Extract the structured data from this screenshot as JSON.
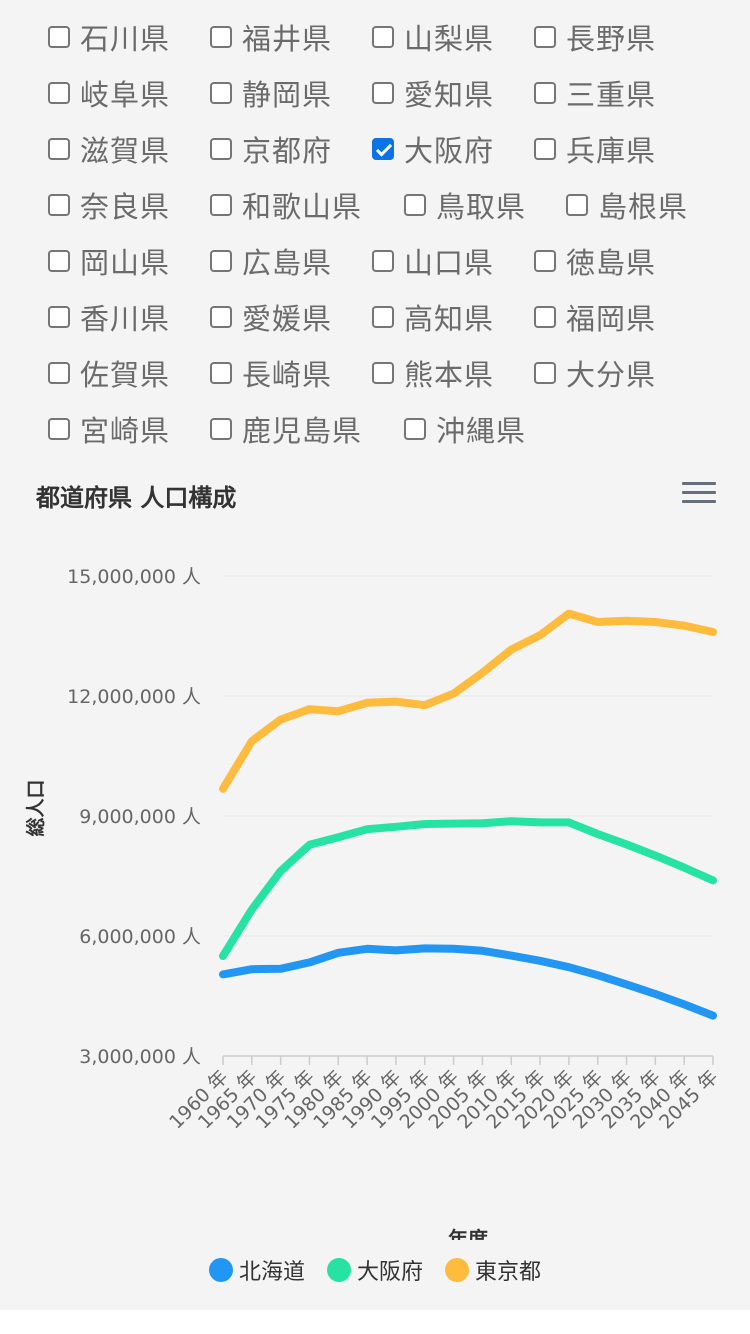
{
  "prefectures": [
    {
      "label": "石川県",
      "checked": false
    },
    {
      "label": "福井県",
      "checked": false
    },
    {
      "label": "山梨県",
      "checked": false
    },
    {
      "label": "長野県",
      "checked": false
    },
    {
      "label": "岐阜県",
      "checked": false
    },
    {
      "label": "静岡県",
      "checked": false
    },
    {
      "label": "愛知県",
      "checked": false
    },
    {
      "label": "三重県",
      "checked": false
    },
    {
      "label": "滋賀県",
      "checked": false
    },
    {
      "label": "京都府",
      "checked": false
    },
    {
      "label": "大阪府",
      "checked": true
    },
    {
      "label": "兵庫県",
      "checked": false
    },
    {
      "label": "奈良県",
      "checked": false
    },
    {
      "label": "和歌山県",
      "checked": false
    },
    {
      "label": "鳥取県",
      "checked": false
    },
    {
      "label": "島根県",
      "checked": false
    },
    {
      "label": "岡山県",
      "checked": false
    },
    {
      "label": "広島県",
      "checked": false
    },
    {
      "label": "山口県",
      "checked": false
    },
    {
      "label": "徳島県",
      "checked": false
    },
    {
      "label": "香川県",
      "checked": false
    },
    {
      "label": "愛媛県",
      "checked": false
    },
    {
      "label": "高知県",
      "checked": false
    },
    {
      "label": "福岡県",
      "checked": false
    },
    {
      "label": "佐賀県",
      "checked": false
    },
    {
      "label": "長崎県",
      "checked": false
    },
    {
      "label": "熊本県",
      "checked": false
    },
    {
      "label": "大分県",
      "checked": false
    },
    {
      "label": "宮崎県",
      "checked": false
    },
    {
      "label": "鹿児島県",
      "checked": false
    },
    {
      "label": "沖縄県",
      "checked": false
    }
  ],
  "chart_title": "都道府県 人口構成",
  "menu_icon": "hamburger-menu-icon",
  "chart_data": {
    "type": "line",
    "title": "都道府県 人口構成",
    "xlabel": "年度",
    "ylabel": "総人口",
    "categories": [
      "1960 年",
      "1965 年",
      "1970 年",
      "1975 年",
      "1980 年",
      "1985 年",
      "1990 年",
      "1995 年",
      "2000 年",
      "2005 年",
      "2010 年",
      "2015 年",
      "2020 年",
      "2025 年",
      "2030 年",
      "2035 年",
      "2040 年",
      "2045 年"
    ],
    "y_ticks": [
      3000000,
      6000000,
      9000000,
      12000000,
      15000000
    ],
    "y_tick_labels": [
      "3,000,000 人",
      "6,000,000 人",
      "9,000,000 人",
      "12,000,000 人",
      "15,000,000 人"
    ],
    "ylim": [
      3000000,
      15000000
    ],
    "grid": true,
    "legend_position": "bottom",
    "series": [
      {
        "name": "北海道",
        "color": "#2196f3",
        "values": [
          5040000,
          5170000,
          5180000,
          5340000,
          5580000,
          5680000,
          5640000,
          5690000,
          5680000,
          5630000,
          5510000,
          5380000,
          5220000,
          5020000,
          4790000,
          4550000,
          4290000,
          4010000
        ]
      },
      {
        "name": "大阪府",
        "color": "#26e3a4",
        "values": [
          5500000,
          6660000,
          7620000,
          8280000,
          8470000,
          8670000,
          8730000,
          8800000,
          8810000,
          8820000,
          8870000,
          8840000,
          8840000,
          8550000,
          8290000,
          8010000,
          7710000,
          7390000
        ]
      },
      {
        "name": "東京都",
        "color": "#ffbb3d",
        "values": [
          9680000,
          10870000,
          11410000,
          11670000,
          11620000,
          11830000,
          11860000,
          11770000,
          12060000,
          12580000,
          13160000,
          13520000,
          14060000,
          13850000,
          13880000,
          13850000,
          13760000,
          13600000
        ]
      }
    ]
  }
}
